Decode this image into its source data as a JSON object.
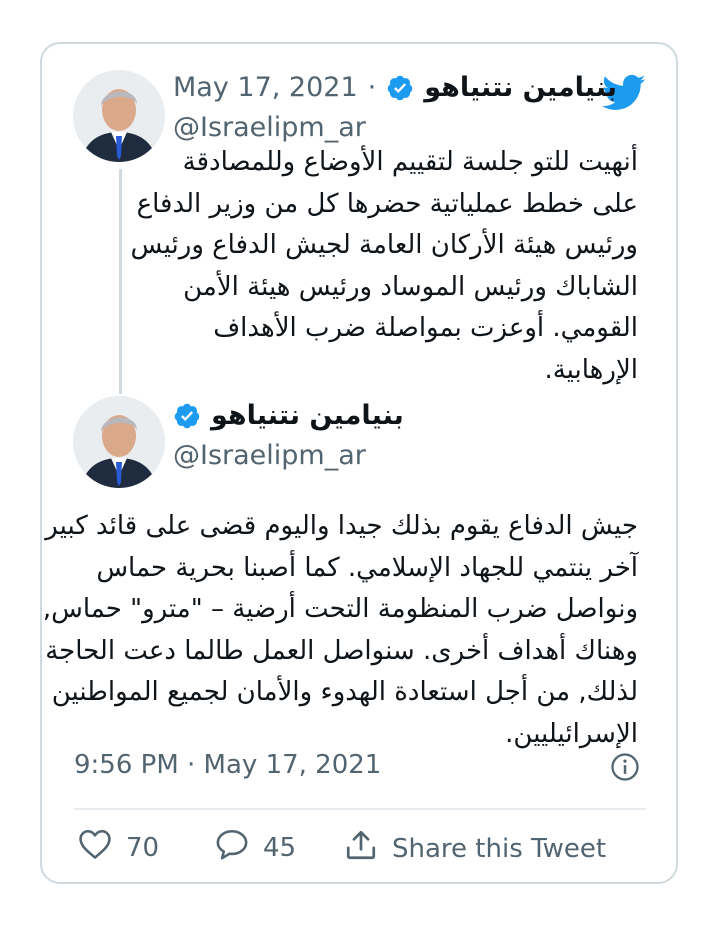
{
  "tweet1": {
    "author_name": "بنيامين نتنياهو",
    "handle": "@Israelipm_ar",
    "separator": "·",
    "date": "May 17, 2021",
    "text": "أنهيت للتو جلسة لتقييم الأوضاع وللمصادقة\nعلى خطط عملياتية حضرها كل من وزير الدفاع\nورئيس هيئة الأركان العامة لجيش الدفاع ورئيس\nالشاباك ورئيس الموساد ورئيس هيئة الأمن\nالقومي. أوعزت بمواصلة ضرب الأهداف\nالإرهابية."
  },
  "tweet2": {
    "author_name": "بنيامين نتنياهو",
    "handle": "@Israelipm_ar",
    "text": "جيش الدفاع يقوم بذلك جيدا واليوم قضى على قائد كبير\nآخر ينتمي للجهاد الإسلامي. كما أصبنا بحرية حماس\nونواصل ضرب المنظومة التحت أرضية – \"مترو\" حماس,\nوهناك أهداف أخرى. سنواصل العمل طالما دعت الحاجة\nلذلك, من أجل استعادة الهدوء والأمان لجميع المواطنين\nالإسرائيليين."
  },
  "meta": {
    "timestamp": "9:56 PM · May 17, 2021"
  },
  "actions": {
    "likes": "70",
    "replies": "45",
    "share_label": "Share this Tweet"
  },
  "colors": {
    "twitter_blue": "#1d9bf0",
    "text_secondary": "#536471",
    "border": "#cfd9de"
  },
  "icons": [
    "twitter-logo-icon",
    "verified-icon",
    "info-icon",
    "heart-icon",
    "reply-icon",
    "share-icon"
  ]
}
